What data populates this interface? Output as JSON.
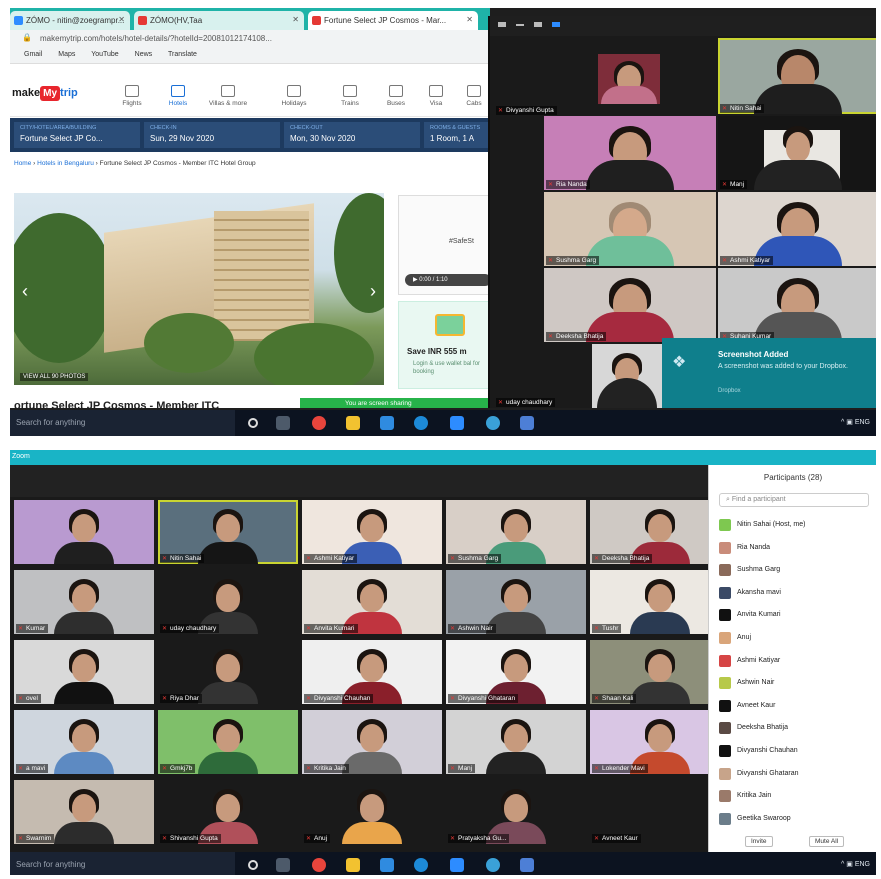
{
  "top": {
    "tabs": [
      {
        "label": "ZÓMO - nitin@zoegrampr..."
      },
      {
        "label": "ZÓMO(HV,Taa"
      },
      {
        "label": "Fortune Select JP Cosmos - Mar..."
      }
    ],
    "address_bar": "makemytrip.com/hotels/hotel-details/?hotelId=20081012174108...",
    "bookmarks": [
      "Gmail",
      "Maps",
      "YouTube",
      "News",
      "Translate"
    ],
    "site": {
      "logo_text": "make",
      "logo_highlight": "My",
      "logo_suffix": "trip",
      "nav": [
        "Flights",
        "Hotels",
        "Villas & more",
        "Holidays",
        "Trains",
        "Buses",
        "Visa",
        "Cabs"
      ],
      "search_fields": [
        {
          "label": "CITY/HOTEL/AREA/BUILDING",
          "value": "Fortune Select JP Co..."
        },
        {
          "label": "CHECK-IN",
          "value": "Sun, 29 Nov 2020"
        },
        {
          "label": "CHECK-OUT",
          "value": "Mon, 30 Nov 2020"
        },
        {
          "label": "ROOMS & GUESTS",
          "value": "1 Room, 1 A"
        }
      ],
      "breadcrumb_home": "Home",
      "breadcrumb_city": "Hotels in Bengaluru",
      "breadcrumb_hotel": "Fortune Select JP Cosmos - Member ITC Hotel Group",
      "view_all": "VIEW ALL 90 PHOTOS",
      "video_hashtag": "#SafeSt",
      "video_time": "0:00 / 1:10",
      "offer_title": "Save INR 555 m",
      "offer_sub": "Login & use wallet bal for booking",
      "hotel_title": "ortune Select JP Cosmos - Member ITC",
      "share_bar": "You are screen sharing"
    },
    "participants": [
      {
        "name": "Divyanshi Gupta"
      },
      {
        "name": "Nitin Sahai"
      },
      {
        "name": "Ria Nanda"
      },
      {
        "name": "Manj"
      },
      {
        "name": "Sushma Garg"
      },
      {
        "name": "Ashmi Katiyar"
      },
      {
        "name": "Deeksha Bhatija"
      },
      {
        "name": "Suhani Kumar"
      },
      {
        "name": "uday chaudhary"
      }
    ],
    "dropbox": {
      "title": "Screenshot Added",
      "text": "A screenshot was added to your Dropbox.",
      "brand": "Dropbox"
    },
    "taskbar": {
      "search": "Search for anything",
      "tray": "ENG"
    }
  },
  "bottom": {
    "app_title": "Zoom",
    "gallery": [
      {
        "name": ""
      },
      {
        "name": "Nitin Sahai"
      },
      {
        "name": "Ashmi Katiyar"
      },
      {
        "name": "Sushma Garg"
      },
      {
        "name": "Deeksha Bhatija"
      },
      {
        "name": "Kumar"
      },
      {
        "name": "uday chaudhary"
      },
      {
        "name": "Anvita Kumari"
      },
      {
        "name": "Ashwin Nair"
      },
      {
        "name": "Tushr"
      },
      {
        "name": "ovel"
      },
      {
        "name": "Riya Dhar"
      },
      {
        "name": "Divyanshi Chauhan"
      },
      {
        "name": "Divyanshi Ghataran"
      },
      {
        "name": "Shaan Kali"
      },
      {
        "name": "a mavi"
      },
      {
        "name": "Gmkj7b"
      },
      {
        "name": "Kritika Jain"
      },
      {
        "name": "Manj"
      },
      {
        "name": "Lokender Mavi"
      },
      {
        "name": "Swarnim"
      },
      {
        "name": "Shivanshi Gupta"
      },
      {
        "name": "Anuj"
      },
      {
        "name": "Pratyaksha Gu..."
      },
      {
        "name": "Avneet Kaur"
      }
    ],
    "participants_panel": {
      "title": "Participants (28)",
      "find_placeholder": "Find a participant",
      "rows": [
        {
          "name": "Nitin Sahai (Host, me)",
          "color": "#7ec850"
        },
        {
          "name": "Ria Nanda",
          "color": "#c98c7a"
        },
        {
          "name": "Sushma Garg",
          "color": "#8a6a5a"
        },
        {
          "name": "Akansha mavi",
          "color": "#3b4a66"
        },
        {
          "name": "Anvita Kumari",
          "color": "#111111"
        },
        {
          "name": "Anuj",
          "color": "#d9a57a"
        },
        {
          "name": "Ashmi Katiyar",
          "color": "#d64545"
        },
        {
          "name": "Ashwin Nair",
          "color": "#b7c94a"
        },
        {
          "name": "Avneet Kaur",
          "color": "#111111"
        },
        {
          "name": "Deeksha Bhatija",
          "color": "#5a4a44"
        },
        {
          "name": "Divyanshi Chauhan",
          "color": "#111111"
        },
        {
          "name": "Divyanshi Ghataran",
          "color": "#c7a48a"
        },
        {
          "name": "Kritika Jain",
          "color": "#9a7a6a"
        },
        {
          "name": "Geetika Swaroop",
          "color": "#6b7d8a"
        }
      ],
      "invite_label": "Invite",
      "mute_all_label": "Mute All"
    },
    "taskbar": {
      "search": "Search for anything",
      "tray": "ENG"
    }
  }
}
